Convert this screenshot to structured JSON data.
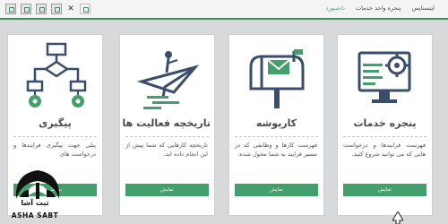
{
  "breadcrumb": {
    "items": [
      "اینستا‌پس",
      "پنجره واحد خدمات",
      "داشبورد"
    ]
  },
  "cards": [
    {
      "title": "پنجره خدمات",
      "description": "فهرست فرایندها و درخواست هایی که می توانید شروع کنید.",
      "button": "نمایش",
      "icon": "monitor-gear-icon"
    },
    {
      "title": "کارپوشه",
      "description": "فهرست کارها و وظایفی که در مسیر فرایند به شما محول شده.",
      "button": "نمایش",
      "icon": "mailbox-icon"
    },
    {
      "title": "تاریخچه فعالیت ها",
      "description": "تاریخچه کارهایی که شما پیش از این انجام داده اید.",
      "button": "نمایش",
      "icon": "paper-plane-icon"
    },
    {
      "title": "پیگیری",
      "description": "پنلی جهت پیگیری فرایندها و درخواست های",
      "button": "نمایش",
      "icon": "flowchart-icon"
    }
  ],
  "logo": {
    "persian_text": "ثبت آشا",
    "english_text": "ASHA SABT"
  },
  "colors": {
    "accent": "#43a06c",
    "background": "#d8d9db",
    "card": "#ffffff"
  }
}
